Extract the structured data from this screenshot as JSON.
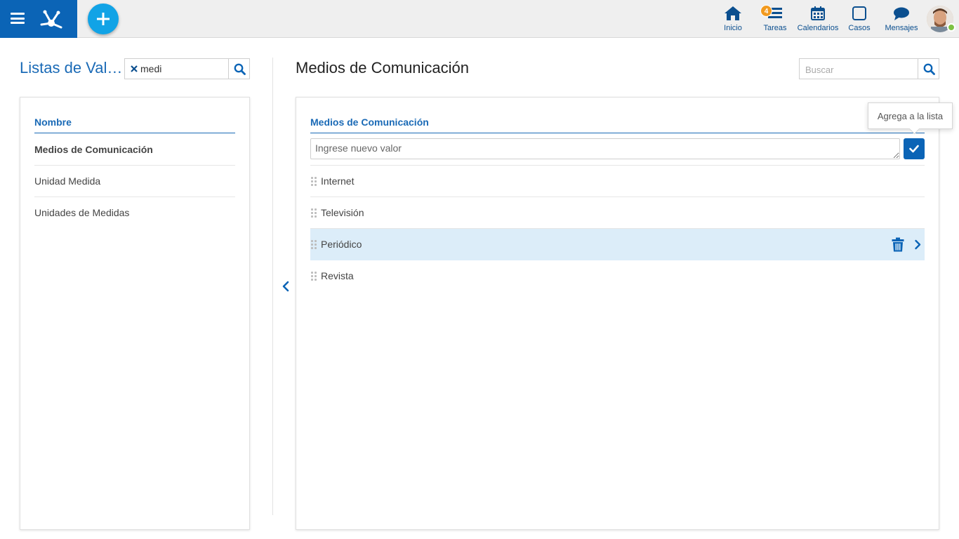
{
  "topbar": {
    "colors": {
      "brand": "#0b64b6",
      "accent": "#11a3e6",
      "badge": "#f29a1f",
      "online": "#7dc243"
    },
    "menu_icon": "hamburger-icon",
    "logo_icon": "app-logo-icon",
    "add_icon": "plus-icon",
    "nav": [
      {
        "label": "Inicio",
        "icon": "home-icon"
      },
      {
        "label": "Tareas",
        "icon": "tasks-icon",
        "badge": "4"
      },
      {
        "label": "Calendarios",
        "icon": "calendar-icon"
      },
      {
        "label": "Casos",
        "icon": "cases-icon"
      },
      {
        "label": "Mensajes",
        "icon": "messages-icon"
      }
    ],
    "avatar": "user-avatar"
  },
  "left": {
    "title": "Listas de Valores",
    "filter_value": "medi",
    "column_header": "Nombre",
    "items": [
      {
        "label": "Medios de Comunicación",
        "active": true
      },
      {
        "label": "Unidad Medida"
      },
      {
        "label": "Unidades de Medidas"
      }
    ]
  },
  "right": {
    "title": "Medios de Comunicación",
    "search_placeholder": "Buscar",
    "column_header": "Medios de Comunicación",
    "new_value_placeholder": "Ingrese nuevo valor",
    "tooltip": "Agrega a la lista",
    "values": [
      {
        "label": "Internet"
      },
      {
        "label": "Televisión"
      },
      {
        "label": "Periódico",
        "selected": true
      },
      {
        "label": "Revista"
      }
    ]
  }
}
